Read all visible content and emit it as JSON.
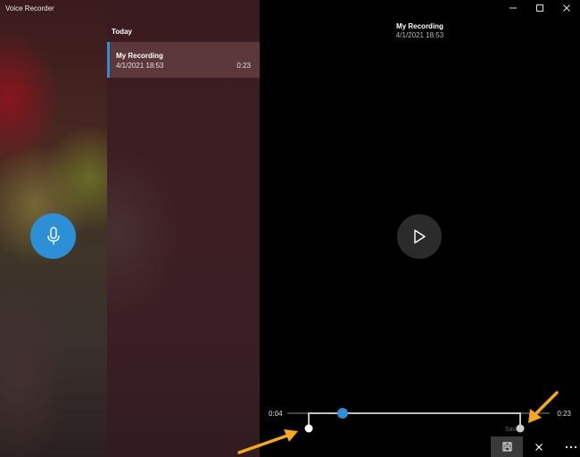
{
  "app": {
    "title": "Voice Recorder"
  },
  "window_controls": [
    {
      "name": "minimize-icon",
      "glyph": "minimize"
    },
    {
      "name": "maximize-icon",
      "glyph": "maximize"
    },
    {
      "name": "close-icon",
      "glyph": "close"
    }
  ],
  "recordings": {
    "group_label": "Today",
    "items": [
      {
        "title": "My Recording",
        "date": "4/1/2021 18:53",
        "duration": "0:23"
      }
    ]
  },
  "player": {
    "title": "My Recording",
    "date": "4/1/2021 18:53",
    "trim": {
      "start_label": "0:04",
      "end_label": "0:23",
      "start_fraction": 0.0,
      "playhead_fraction": 0.16,
      "end_fraction": 1.0
    },
    "save_hint": "Save",
    "bottom_bar": [
      {
        "name": "save-icon",
        "active": true
      },
      {
        "name": "cancel-icon",
        "active": false
      },
      {
        "name": "more-options-icon",
        "active": false
      }
    ]
  },
  "colors": {
    "accent": "#2d8fd5",
    "annotation_arrow": "#f5a623",
    "player_background": "#000000"
  }
}
